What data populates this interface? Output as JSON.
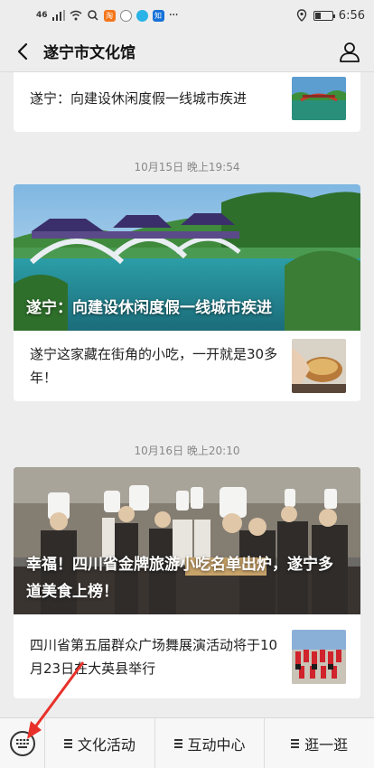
{
  "status_bar": {
    "network": "46",
    "time": "6:56",
    "battery_level": 0.35,
    "dots": "···"
  },
  "nav": {
    "title": "遂宁市文化馆"
  },
  "feed": {
    "top_partial": {
      "text": "遂宁：向建设休闲度假一线城市疾进"
    },
    "groups": [
      {
        "timestamp": "10月15日 晚上19:54",
        "hero_title": "遂宁：向建设休闲度假一线城市疾进",
        "item_text": "遂宁这家藏在街角的小吃，一开就是30多年！"
      },
      {
        "timestamp": "10月16日 晚上20:10",
        "hero_title": "幸福！四川省金牌旅游小吃名单出炉，遂宁多道美食上榜！",
        "item_text": "四川省第五届群众广场舞展演活动将于10月23日在大英县举行"
      }
    ]
  },
  "bottom_menu": {
    "items": [
      {
        "label": "文化活动"
      },
      {
        "label": "互动中心"
      },
      {
        "label": "逛一逛"
      }
    ]
  },
  "colors": {
    "background": "#ededed",
    "card": "#ffffff",
    "arrow": "#e8302a"
  }
}
